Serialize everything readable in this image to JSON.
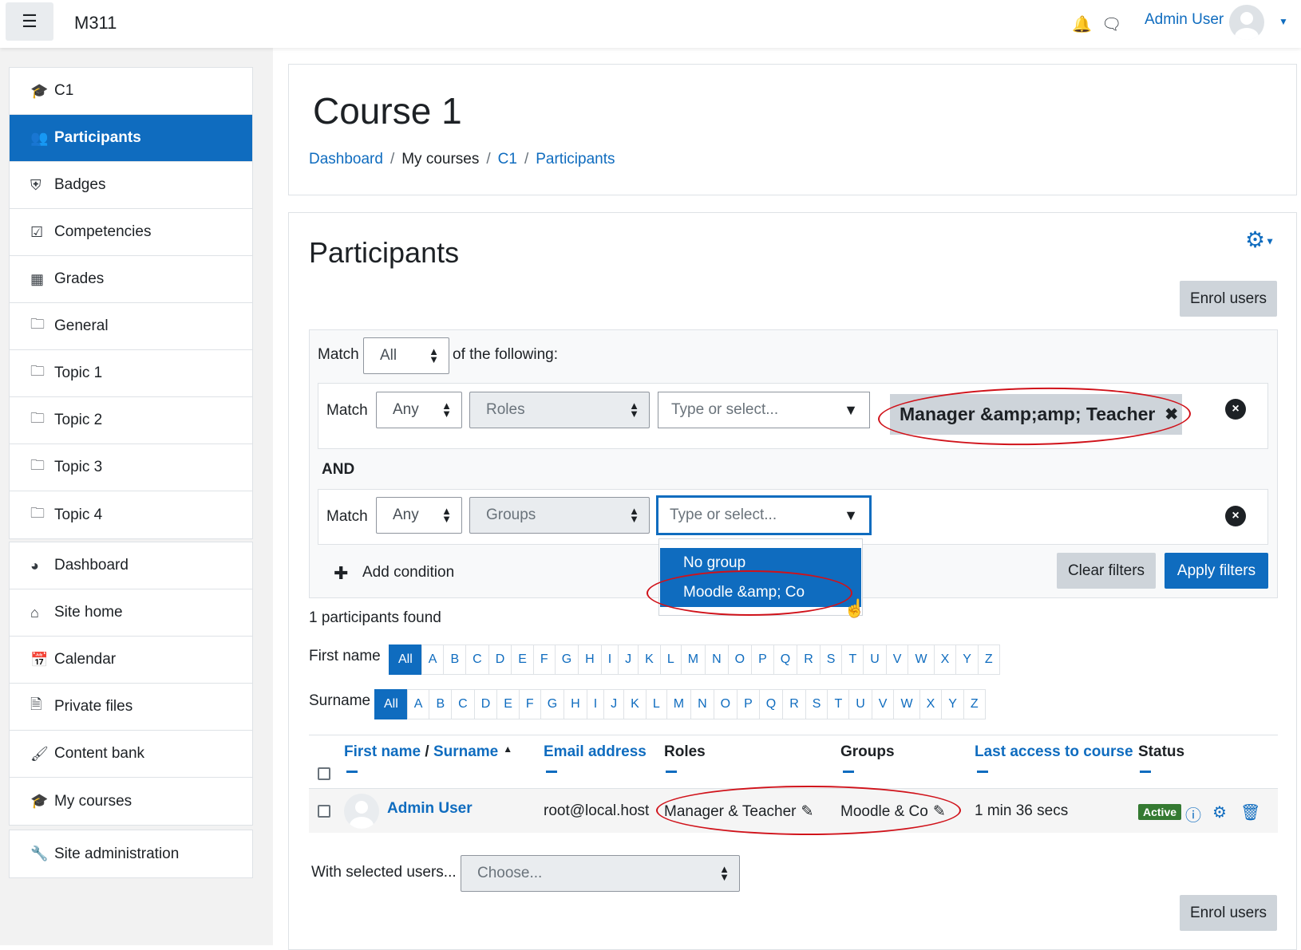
{
  "topbar": {
    "site_name": "M311",
    "user_name": "Admin User",
    "icons": [
      "menu-icon",
      "bell-icon",
      "chat-icon",
      "avatar",
      "caret-down-icon"
    ]
  },
  "nav": {
    "course_items": [
      {
        "label": "C1",
        "icon": "graduation-cap-icon"
      },
      {
        "label": "Participants",
        "icon": "users-icon"
      },
      {
        "label": "Badges",
        "icon": "shield-icon"
      },
      {
        "label": "Competencies",
        "icon": "checkbox-icon"
      },
      {
        "label": "Grades",
        "icon": "table-icon"
      },
      {
        "label": "General",
        "icon": "folder-icon"
      },
      {
        "label": "Topic 1",
        "icon": "folder-icon"
      },
      {
        "label": "Topic 2",
        "icon": "folder-icon"
      },
      {
        "label": "Topic 3",
        "icon": "folder-icon"
      },
      {
        "label": "Topic 4",
        "icon": "folder-icon"
      }
    ],
    "site_items": [
      {
        "label": "Dashboard",
        "icon": "tachometer-icon"
      },
      {
        "label": "Site home",
        "icon": "home-icon"
      },
      {
        "label": "Calendar",
        "icon": "calendar-icon"
      },
      {
        "label": "Private files",
        "icon": "file-icon"
      },
      {
        "label": "Content bank",
        "icon": "brush-icon"
      },
      {
        "label": "My courses",
        "icon": "graduation-cap-icon"
      }
    ],
    "admin_items": [
      {
        "label": "Site administration",
        "icon": "wrench-icon"
      }
    ]
  },
  "header": {
    "title": "Course 1",
    "breadcrumb": [
      "Dashboard",
      "My courses",
      "C1",
      "Participants"
    ]
  },
  "participants": {
    "title": "Participants",
    "enrol_button": "Enrol users",
    "filters": {
      "match_label": "Match",
      "match_value": "All",
      "of_following": "of the following:",
      "join_label": "AND",
      "row1": {
        "match_label": "Match",
        "match_value": "Any",
        "field": "Roles",
        "placeholder": "Type or select...",
        "selected_tag": "Manager &amp;amp; Teacher"
      },
      "row2": {
        "match_label": "Match",
        "match_value": "Any",
        "field": "Groups",
        "placeholder": "Type or select..."
      },
      "dropdown_options": [
        "No group",
        "Moodle &amp; Co"
      ],
      "add_condition": "Add condition",
      "clear_filters": "Clear filters",
      "apply_filters": "Apply filters"
    },
    "count_text": "1 participants found",
    "initials": {
      "first_name_label": "First name",
      "surname_label": "Surname",
      "all": "All",
      "letters": [
        "A",
        "B",
        "C",
        "D",
        "E",
        "F",
        "G",
        "H",
        "I",
        "J",
        "K",
        "L",
        "M",
        "N",
        "O",
        "P",
        "Q",
        "R",
        "S",
        "T",
        "U",
        "V",
        "W",
        "X",
        "Y",
        "Z"
      ]
    },
    "table": {
      "headers": {
        "first_name": "First name",
        "slash": " / ",
        "surname": "Surname",
        "email": "Email address",
        "roles": "Roles",
        "groups": "Groups",
        "last_access": "Last access to course",
        "status": "Status"
      },
      "rows": [
        {
          "name": "Admin User",
          "email": "root@local.host",
          "roles": "Manager & Teacher",
          "groups": "Moodle & Co",
          "last_access": "1 min 36 secs",
          "status": "Active"
        }
      ]
    },
    "bulk": {
      "label": "With selected users...",
      "placeholder": "Choose..."
    },
    "enrol_button_bottom": "Enrol users"
  }
}
